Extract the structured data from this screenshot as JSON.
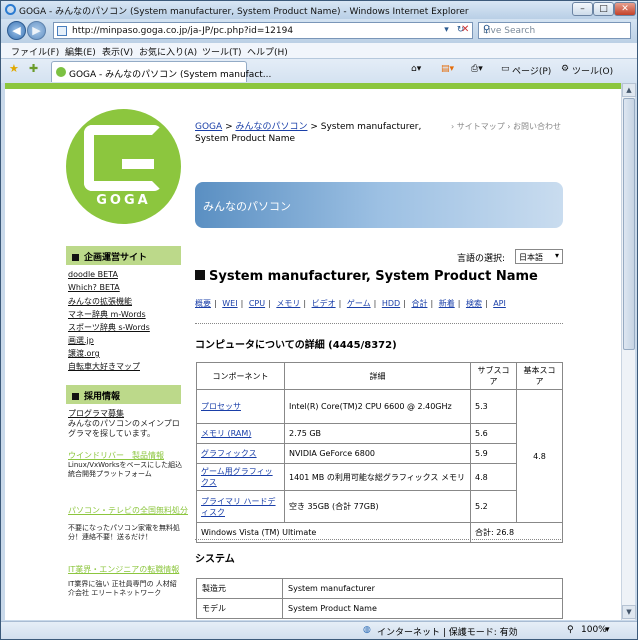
{
  "browser": {
    "title": "GOGA - みんなのパソコン (System manufacturer, System Product Name) - Windows Internet Explorer",
    "url": "http://minpaso.goga.co.jp/ja-JP/pc.php?id=12194",
    "search_placeholder": "Live Search",
    "menu": [
      "ファイル(F)",
      "編集(E)",
      "表示(V)",
      "お気に入り(A)",
      "ツール(T)",
      "ヘルプ(H)"
    ],
    "tab_title": "GOGA - みんなのパソコン (System manufact...",
    "toolbar": {
      "page": "ページ(P)",
      "tools": "ツール(O)"
    },
    "status_zone": "インターネット | 保護モード: 有効",
    "zoom": "100%"
  },
  "logo_text": "GOGA",
  "sidebar": {
    "section1_title": "企画運営サイト",
    "links": [
      "doodle BETA",
      "Which? BETA",
      "みんなの拡張機能",
      "マネー辞典 m-Words",
      "スポーツ辞典 s-Words",
      "画選.jp",
      "譲渡.org",
      "自転車大好きマップ"
    ],
    "section2_title": "採用情報",
    "recruit_link": "プログラマ募集",
    "recruit_note": "みんなのパソコンのメインプログラマを探しています。",
    "ads": [
      {
        "title": "ウインドリバー　製品情報",
        "note": "Linux/VxWorksをベースにした組込統合開発プラットフォーム"
      },
      {
        "title": "パソコン・テレビの全国無料処分",
        "note": "不要になったパソコン家電を無料処分！連絡不要！送るだけ！"
      },
      {
        "title": "IT業界・エンジニアの転職情報",
        "note": "IT業界に強い 正社員専門の 人材紹介会社 エリートネットワーク"
      }
    ]
  },
  "header": {
    "breadcrumb": {
      "home": "GOGA",
      "site": "みんなのパソコン",
      "current": "System manufacturer, System Product Name"
    },
    "sitemap": "サイトマップ",
    "contact": "お問い合わせ",
    "banner": "みんなのパソコン"
  },
  "language": {
    "label": "言語の選択:",
    "selected": "日本語"
  },
  "page_title": "System manufacturer, System Product Name",
  "nav_tabs": [
    "概要",
    "WEI",
    "CPU",
    "メモリ",
    "ビデオ",
    "ゲーム",
    "HDD",
    "合計",
    "新着",
    "検索",
    "API"
  ],
  "detail_heading": "コンピュータについての詳細 (4445/8372)",
  "wei_table": {
    "headers": [
      "コンポーネント",
      "詳細",
      "サブスコア",
      "基本スコア"
    ],
    "rows": [
      {
        "component": "プロセッサ",
        "detail": "Intel(R) Core(TM)2 CPU 6600 @ 2.40GHz",
        "subscore": "5.3"
      },
      {
        "component": "メモリ (RAM)",
        "detail": "2.75 GB",
        "subscore": "5.6"
      },
      {
        "component": "グラフィックス",
        "detail": "NVIDIA GeForce 6800",
        "subscore": "5.9"
      },
      {
        "component": "ゲーム用グラフィックス",
        "detail": "1401 MB の利用可能な総グラフィックス メモリ",
        "subscore": "4.8"
      },
      {
        "component": "プライマリ ハードディスク",
        "detail": "空き 35GB (合計 77GB)",
        "subscore": "5.2"
      }
    ],
    "base_score": "4.8",
    "os": "Windows Vista (TM) Ultimate",
    "total": "合計: 26.8"
  },
  "system_heading": "システム",
  "system_table": [
    {
      "label": "製造元",
      "value": "System manufacturer"
    },
    {
      "label": "モデル",
      "value": "System Product Name"
    }
  ]
}
